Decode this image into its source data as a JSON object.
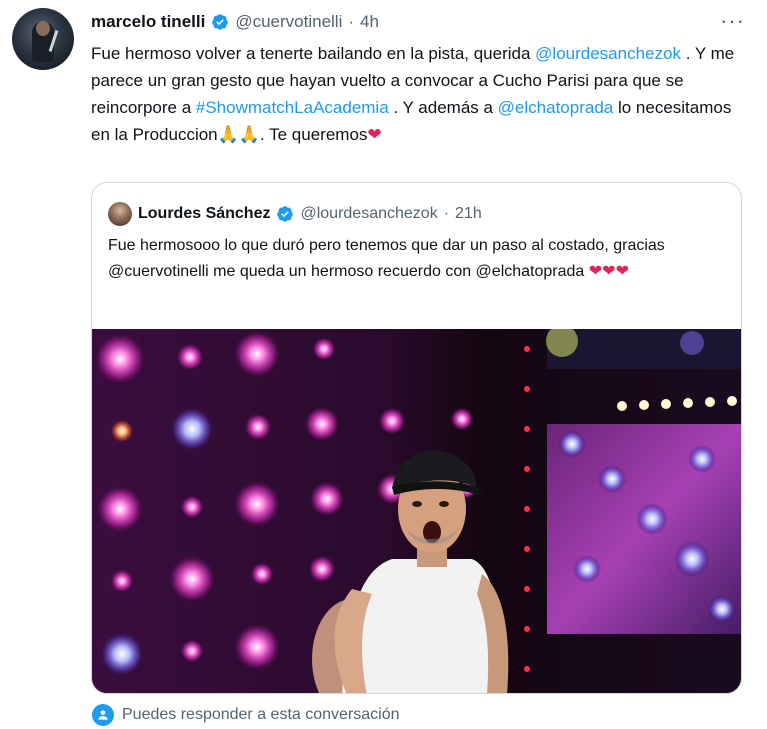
{
  "tweet": {
    "author_name": "marcelo tinelli",
    "author_handle": "@cuervotinelli",
    "separator": "·",
    "time": "4h",
    "more_icon": "more-options-icon",
    "text_parts": {
      "p1": "Fue hermoso volver a tenerte bailando en la pista, querida ",
      "mention1": "@lourdesanchezok",
      "p2": " . Y me parece un gran gesto que hayan vuelto a convocar a Cucho Parisi para que se reincorpore a ",
      "hashtag": "#ShowmatchLaAcademia",
      "p3": " . Y además a ",
      "mention2": "@elchatoprada",
      "p4": " lo necesitamos en la Produccion",
      "emoji_hands": "🙏🙏",
      "p5": ". Te queremos",
      "emoji_heart": "❤"
    }
  },
  "quote": {
    "author_name": "Lourdes Sánchez",
    "author_handle": "@lourdesanchezok",
    "separator": "·",
    "time": "21h",
    "text": "Fue hermosooo lo que duró pero tenemos que dar un paso al costado, gracias @cuervotinelli me queda un hermoso recuerdo con @elchatoprada ",
    "hearts": "❤❤❤"
  },
  "reply_notice": {
    "icon": "person-at-icon",
    "text": "Puedes responder a esta conversación"
  },
  "colors": {
    "link": "#1d9bf0",
    "secondary_text": "#536471",
    "border": "#cfd9de",
    "heart": "#e0245e"
  }
}
